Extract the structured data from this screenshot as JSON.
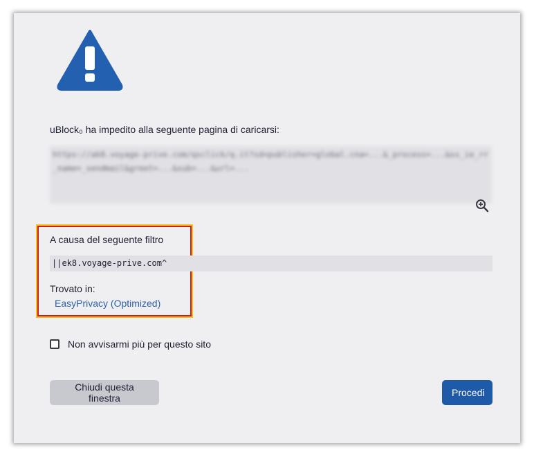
{
  "colors": {
    "accent": "#1f5aa8",
    "warning_icon": "#2460b0",
    "highlight_border": "#d11a1a",
    "highlight_outline": "#f2c019"
  },
  "icons": {
    "warning": "warning-triangle-icon",
    "zoom": "zoom-in-icon"
  },
  "headline": "uBlock₀ ha impedito alla seguente pagina di caricarsi:",
  "blocked_url": "https://ak8.voyage-prive.com/qsclick/q.it?sd=publisher=global.cna=...&_process=...&ss_ie_rr_name=_sendmail&greet=...&sub=...&url=...",
  "filter": {
    "label": "A causa del seguente filtro",
    "value": "||ek8.voyage-prive.com^",
    "found_in_label": "Trovato in:",
    "list_name": "EasyPrivacy (Optimized)"
  },
  "dont_warn": {
    "label": "Non avvisarmi più per questo sito",
    "checked": false
  },
  "buttons": {
    "close": "Chiudi questa finestra",
    "proceed": "Procedi"
  }
}
